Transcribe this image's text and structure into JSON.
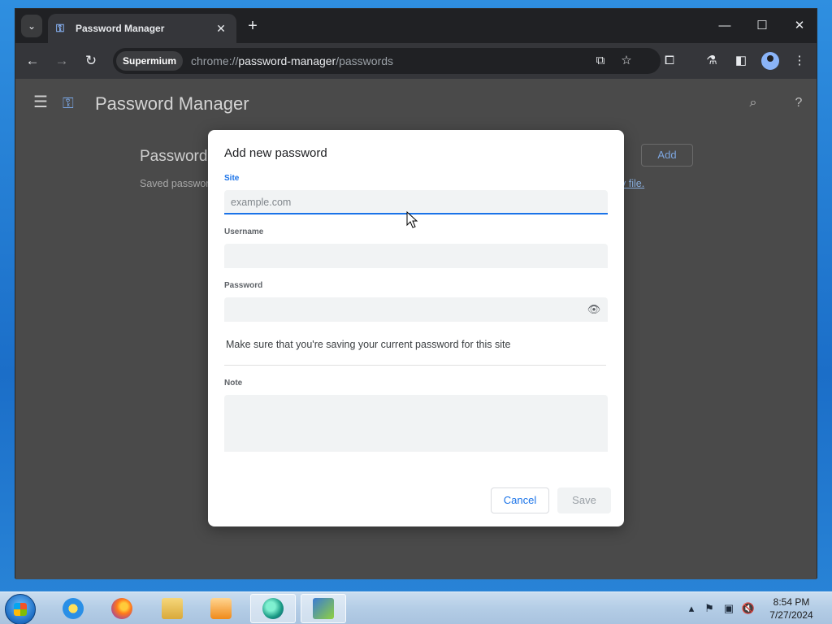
{
  "browser": {
    "tab_title": "Password Manager",
    "profile_chip": "Supermium",
    "url_scheme": "chrome://",
    "url_host": "password-manager",
    "url_path": "/passwords",
    "tab_close_glyph": "✕",
    "new_tab_glyph": "+",
    "minimize_glyph": "—",
    "maximize_glyph": "☐",
    "close_glyph": "✕"
  },
  "page": {
    "title": "Password Manager",
    "heading": "Passwords",
    "subtext": "Saved passwords",
    "link_tail": "y file.",
    "add_label": "Add"
  },
  "dialog": {
    "title": "Add new password",
    "site_label": "Site",
    "site_placeholder": "example.com",
    "username_label": "Username",
    "password_label": "Password",
    "hint": "Make sure that you're saving your current password for this site",
    "note_label": "Note",
    "cancel_label": "Cancel",
    "save_label": "Save"
  },
  "taskbar": {
    "time": "8:54 PM",
    "date": "7/27/2024"
  },
  "colors": {
    "accent": "#1a73e8",
    "chrome_dark": "#202124",
    "toolbar": "#35363a",
    "scrim_page": "#4a4a4a"
  },
  "icons": [
    "tab-search-icon",
    "key-icon",
    "back-icon",
    "forward-icon",
    "reload-icon",
    "install-icon",
    "star-icon",
    "extensions-icon",
    "labs-icon",
    "side-panel-icon",
    "profile-icon",
    "menu-icon",
    "hamburger-icon",
    "search-icon",
    "help-icon",
    "eye-icon"
  ]
}
